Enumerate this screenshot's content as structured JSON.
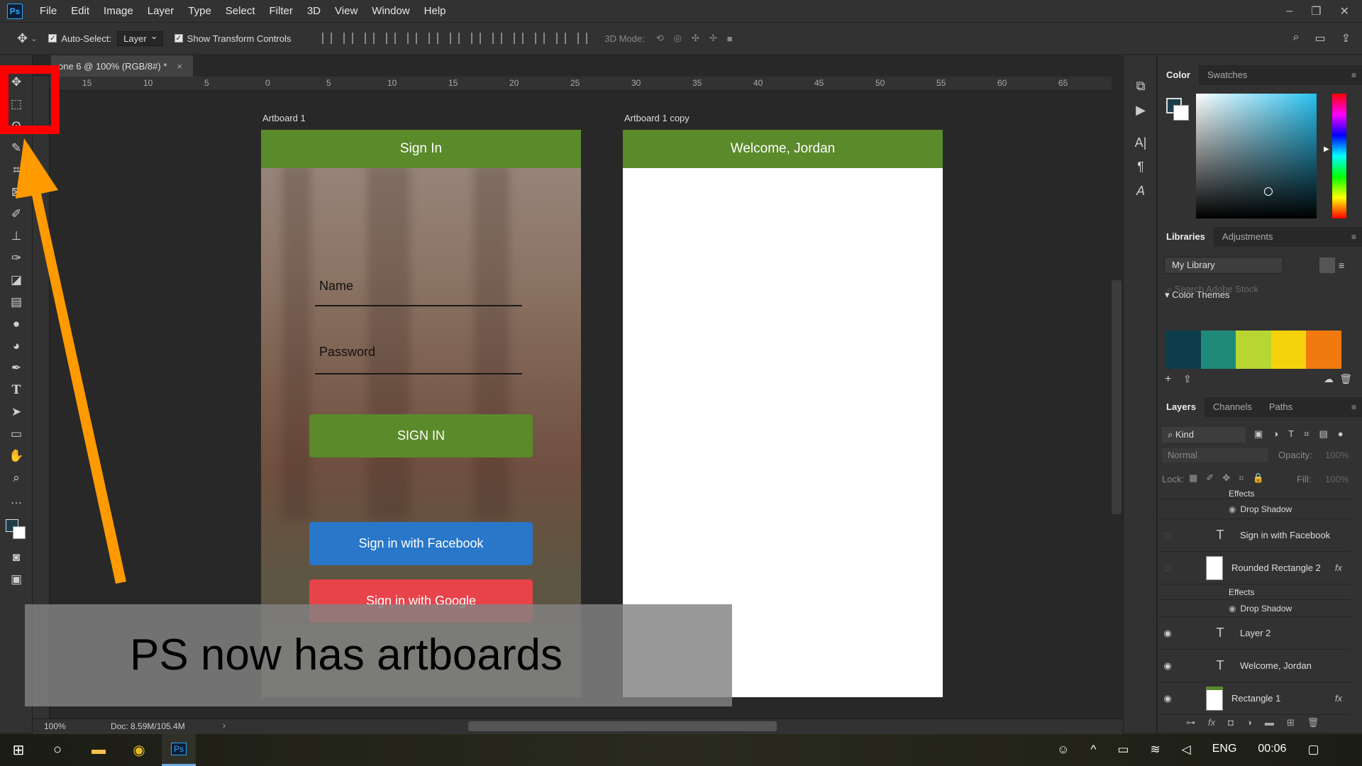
{
  "app": {
    "logo": "Ps"
  },
  "menu": [
    "File",
    "Edit",
    "Image",
    "Layer",
    "Type",
    "Select",
    "Filter",
    "3D",
    "View",
    "Window",
    "Help"
  ],
  "options": {
    "auto_select_label": "Auto-Select:",
    "auto_select_value": "Layer",
    "transform_label": "Show Transform Controls",
    "mode_3d_label": "3D Mode:"
  },
  "document": {
    "tab_title": "one 6 @ 100% (RGB/8#) *",
    "zoom": "100%",
    "doc_info": "Doc: 8.59M/105.4M"
  },
  "ruler": [
    "15",
    "10",
    "5",
    "0",
    "5",
    "10",
    "15",
    "20",
    "25",
    "30",
    "35",
    "40",
    "45",
    "50",
    "55",
    "60",
    "65"
  ],
  "artboard1": {
    "label": "Artboard 1",
    "header": "Sign In",
    "name_label": "Name",
    "password_label": "Password",
    "sign_in_button": "SIGN IN",
    "facebook_button": "Sign in with Facebook",
    "google_button": "Sign in with Google"
  },
  "artboard2": {
    "label": "Artboard 1 copy",
    "header": "Welcome, Jordan"
  },
  "overlay": {
    "caption": "PS now has artboards"
  },
  "color_panel": {
    "tabs": [
      "Color",
      "Swatches"
    ],
    "fg_color": "#1e3d4a",
    "bg_color": "#ffffff"
  },
  "libraries": {
    "tabs": [
      "Libraries",
      "Adjustments"
    ],
    "library": "My Library",
    "search_placeholder": "Search Adobe Stock",
    "themes_label": "Color Themes",
    "theme_colors": [
      "#0d3d4a",
      "#1f8a78",
      "#b8d532",
      "#f5d20d",
      "#f07a0d"
    ]
  },
  "layers": {
    "tabs": [
      "Layers",
      "Channels",
      "Paths"
    ],
    "kind_label": "Kind",
    "blend_mode": "Normal",
    "opacity_label": "Opacity:",
    "opacity": "100%",
    "lock_label": "Lock:",
    "fill_label": "Fill:",
    "fill": "100%",
    "rows": [
      {
        "name": "Effects"
      },
      {
        "name": "Drop Shadow"
      },
      {
        "name": "Sign in with Facebook"
      },
      {
        "name": "Rounded Rectangle 2"
      },
      {
        "name": "Effects"
      },
      {
        "name": "Drop Shadow"
      },
      {
        "name": "Layer 2"
      },
      {
        "name": "Welcome, Jordan"
      },
      {
        "name": "Rectangle 1"
      }
    ]
  },
  "taskbar": {
    "language": "ENG",
    "time": "00:06"
  },
  "annotation": {
    "arrow_color": "#ff9a00",
    "box_color": "#ff0000"
  }
}
